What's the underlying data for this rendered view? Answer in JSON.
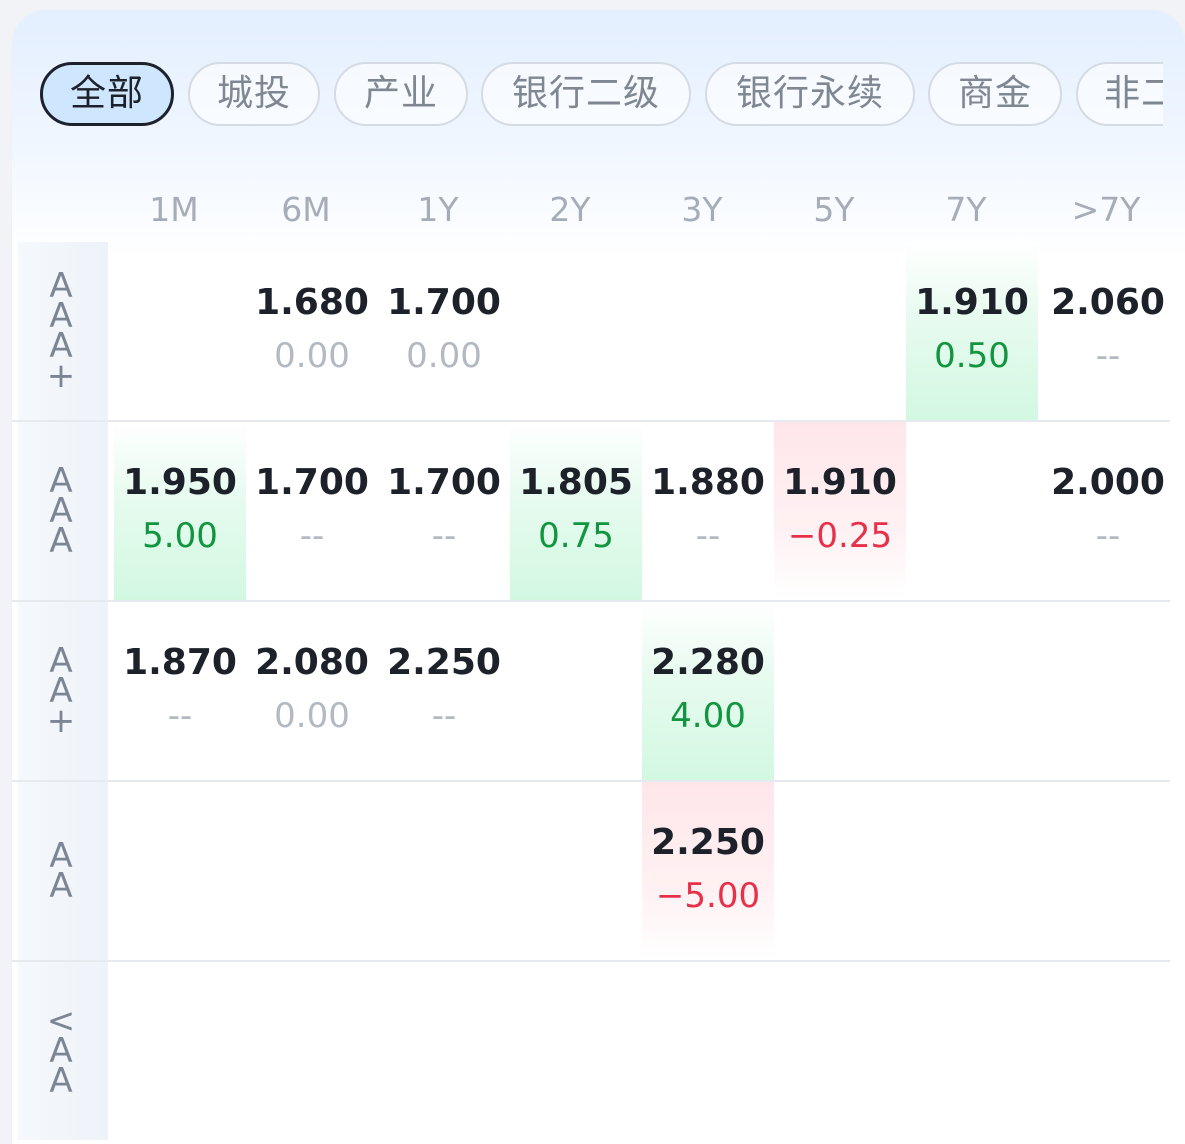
{
  "tabs": [
    "全部",
    "城投",
    "产业",
    "银行二级",
    "银行永续",
    "商金",
    "非二"
  ],
  "active_tab": "全部",
  "columns": [
    "1M",
    "6M",
    "1Y",
    "2Y",
    "3Y",
    "5Y",
    "7Y",
    ">7Y"
  ],
  "rows": [
    {
      "label": "A\nA\nA\n+",
      "cells": [
        null,
        {
          "value": "1.680",
          "change": "0.00",
          "trend": "flat"
        },
        {
          "value": "1.700",
          "change": "0.00",
          "trend": "flat"
        },
        null,
        null,
        null,
        {
          "value": "1.910",
          "change": "0.50",
          "trend": "up"
        },
        {
          "value": "2.060",
          "change": "--",
          "trend": "flat"
        }
      ]
    },
    {
      "label": "A\nA\nA",
      "cells": [
        {
          "value": "1.950",
          "change": "5.00",
          "trend": "up"
        },
        {
          "value": "1.700",
          "change": "--",
          "trend": "flat"
        },
        {
          "value": "1.700",
          "change": "--",
          "trend": "flat"
        },
        {
          "value": "1.805",
          "change": "0.75",
          "trend": "up"
        },
        {
          "value": "1.880",
          "change": "--",
          "trend": "flat"
        },
        {
          "value": "1.910",
          "change": "−0.25",
          "trend": "down"
        },
        null,
        {
          "value": "2.000",
          "change": "--",
          "trend": "flat"
        }
      ]
    },
    {
      "label": "A\nA\n+",
      "cells": [
        {
          "value": "1.870",
          "change": "--",
          "trend": "flat"
        },
        {
          "value": "2.080",
          "change": "0.00",
          "trend": "flat"
        },
        {
          "value": "2.250",
          "change": "--",
          "trend": "flat"
        },
        null,
        {
          "value": "2.280",
          "change": "4.00",
          "trend": "up"
        },
        null,
        null,
        null
      ]
    },
    {
      "label": "A\nA",
      "cells": [
        null,
        null,
        null,
        null,
        {
          "value": "2.250",
          "change": "−5.00",
          "trend": "down"
        },
        null,
        null,
        null
      ]
    },
    {
      "label": "<\nA\nA",
      "cells": [
        null,
        null,
        null,
        null,
        null,
        null,
        null,
        null
      ]
    }
  ]
}
